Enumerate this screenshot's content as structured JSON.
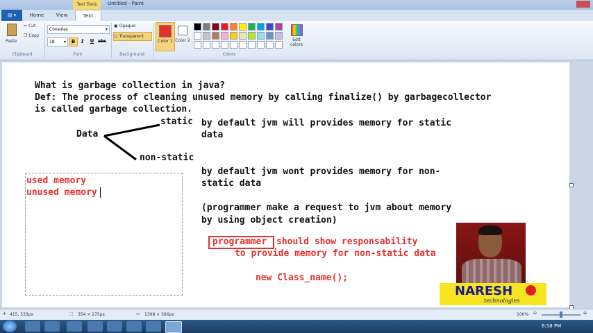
{
  "window": {
    "context_tab": "Text Tools",
    "title": "Untitled - Paint"
  },
  "tabs": [
    "Home",
    "View",
    "Text"
  ],
  "clipboard": {
    "paste": "Paste",
    "cut": "Cut",
    "copy": "Copy",
    "label": "Clipboard"
  },
  "font": {
    "family": "Consolas",
    "size": "18",
    "label": "Font"
  },
  "background": {
    "opaque": "Opaque",
    "transparent": "Transparent",
    "label": "Background"
  },
  "colors": {
    "color1": "Color 1",
    "color2": "Color 2",
    "label": "Colors",
    "edit": "Edit colors",
    "color1_value": "#e53030",
    "color2_value": "#ffffff",
    "palette_row1": [
      "#000000",
      "#7f7f7f",
      "#880015",
      "#ed1c24",
      "#ff7f27",
      "#fff200",
      "#22b14c",
      "#00a2e8",
      "#3f48cc",
      "#a349a4"
    ],
    "palette_row2": [
      "#ffffff",
      "#c3c3c3",
      "#b97a57",
      "#ffaec9",
      "#ffc90e",
      "#efe4b0",
      "#b5e61d",
      "#99d9ea",
      "#7092be",
      "#c8bfe7"
    ]
  },
  "canvas_text": {
    "q": "What is garbage collection in java?",
    "def1": "Def: The process of cleaning unused memory by calling finalize() by garbagecollector",
    "def2": "is called garbage collection.",
    "data": "Data",
    "static": "static",
    "nonstatic": "non-static",
    "s1": "by default jvm will provides memory for static",
    "s2": "data",
    "n1": "by default jvm wont provides memory for non-",
    "n2": "static data",
    "p1": "(programmer make a request to jvm about memory",
    "p2": "by using object creation)",
    "used": "used memory",
    "unused": "unused memory",
    "prog": "programmer",
    "should": "should show responsability",
    "provide": "to provide memory for non-static data",
    "newcls": "new Class_name();"
  },
  "logo": {
    "brand": "NARESH",
    "sub": "technologies"
  },
  "status": {
    "coords": "415, 533px",
    "selection": "354 × 275px",
    "size": "1308 × 566px",
    "zoom": "100%"
  },
  "clock": "6:58 PM"
}
